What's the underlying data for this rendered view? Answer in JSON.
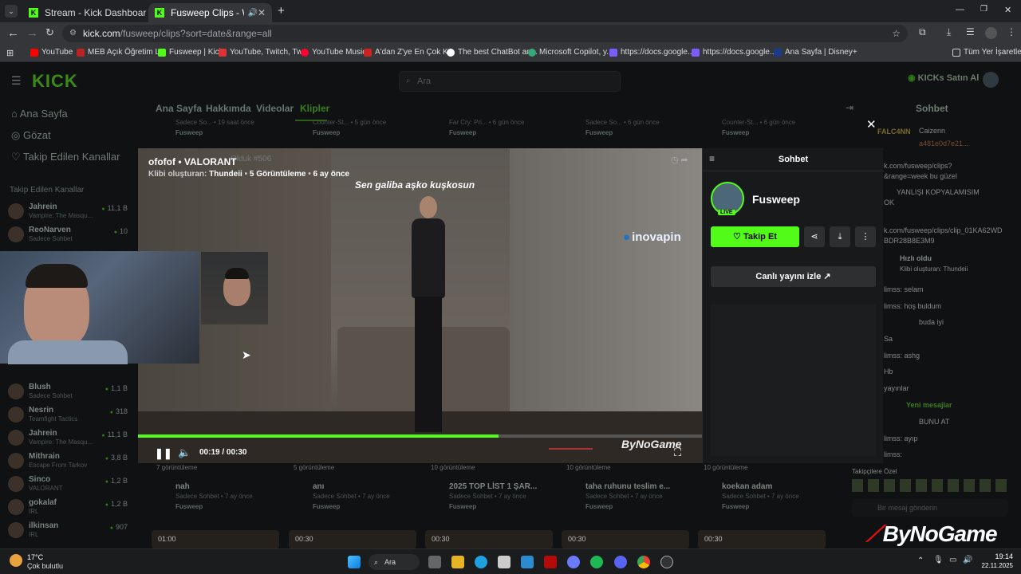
{
  "browser": {
    "tabs": [
      {
        "title": "Stream - Kick Dashboard"
      },
      {
        "title": "Fusweep Clips - Watch Live"
      }
    ],
    "url_host": "kick.com",
    "url_path": "/fusweep/clips?sort=date&range=all",
    "bookmarks": [
      "YouTube",
      "MEB Açık Öğretim L...",
      "Fusweep | Kick",
      "YouTube, Twitch, Tw...",
      "YouTube Music",
      "A'dan Z'ye En Çok K...",
      "The best ChatBot an...",
      "Microsoft Copilot, y...",
      "https://docs.google....",
      "https://docs.google....",
      "Ana Sayfa | Disney+"
    ],
    "all_bookmarks": "Tüm Yer İşaretleri"
  },
  "site": {
    "logo": "KICK",
    "search_placeholder": "Ara",
    "kicks_button": "KICKs Satın Al",
    "nav": [
      "Ana Sayfa",
      "Gözat",
      "Takip Edilen Kanallar"
    ],
    "followed_title": "Takip Edilen Kanallar",
    "channels": [
      {
        "name": "Jahrein",
        "game": "Vampire: The Masqu...",
        "viewers": "11,1 B"
      },
      {
        "name": "ReoNarven",
        "game": "Sadece Sohbet",
        "viewers": "10"
      },
      {
        "name": "Blush",
        "game": "Sadece Sohbet",
        "viewers": "1,1 B"
      },
      {
        "name": "Nesrin",
        "game": "Teamfight Tactics",
        "viewers": "318"
      },
      {
        "name": "Jahrein",
        "game": "Vampire: The Masqu...",
        "viewers": "11,1 B"
      },
      {
        "name": "Mithrain",
        "game": "Escape From Tarkov",
        "viewers": "3,8 B"
      },
      {
        "name": "Sinco",
        "game": "VALORANT",
        "viewers": "1,2 B"
      },
      {
        "name": "gokalaf",
        "game": "IRL",
        "viewers": "1,2 B"
      },
      {
        "name": "ilkinsan",
        "game": "IRL",
        "viewers": "907"
      }
    ],
    "page_tabs": [
      "Ana Sayfa",
      "Hakkımda",
      "Videolar",
      "Klipler"
    ],
    "active_tab": "Klipler",
    "chat_header": "Sohbet",
    "top_clips": [
      {
        "sub": "Sadece So... • 19 saat önce",
        "channel": "Fusweep"
      },
      {
        "sub": "Counter-St... • 5 gün önce",
        "channel": "Fusweep"
      },
      {
        "sub": "Far Cry: Pri... • 6 gün önce",
        "channel": "Fusweep"
      },
      {
        "sub": "Sadece So... • 6 gün önce",
        "channel": "Fusweep"
      },
      {
        "sub": "Counter-St... • 6 gün önce",
        "channel": "Fusweep"
      }
    ],
    "bottom_clips": [
      {
        "views": "7 görüntüleme",
        "title": "nah",
        "sub": "Sadece Sohbet • 7 ay önce",
        "channel": "Fusweep"
      },
      {
        "views": "5 görüntüleme",
        "title": "anı",
        "sub": "Sadece Sohbet • 7 ay önce",
        "channel": "Fusweep"
      },
      {
        "views": "10 görüntüleme",
        "title": "2025 TOP LİST 1 ŞAR...",
        "sub": "Sadece Sohbet • 7 ay önce",
        "channel": "Fusweep"
      },
      {
        "views": "10 görüntüleme",
        "title": "taha ruhunu teslim e...",
        "sub": "Sadece Sohbet • 7 ay önce",
        "channel": "Fusweep"
      },
      {
        "views": "10 görüntüleme",
        "title": "koekan adam",
        "sub": "Sadece Sohbet • 7 ay önce",
        "channel": "Fusweep"
      }
    ],
    "thumb_times": [
      "01:00",
      "00:30",
      "00:30",
      "00:30",
      "00:30"
    ],
    "chat_lines": [
      "FALC4NN",
      "Caizenn",
      "a481e0d7e21...",
      "k.com/fusweep/clips?",
      "&range=week bu güzel",
      "YANLIŞI KOPYALAMISIM",
      "OK",
      "k.com/fusweep/clips/clip_01KA62WD",
      "BDR28B8E3M9",
      "Hızlı oldu",
      "Klibi oluşturan: Thundeii",
      "limss: selam",
      "limss: hoş buldum",
      "buda iyi",
      "Sa",
      "limss: ashg",
      "Hb",
      "yayınlar",
      "Yeni mesajlar",
      "BUNU AT",
      "limss: ayıp",
      "limss:"
    ],
    "chat_input_placeholder": "Bir mesaj gönderin",
    "emote_label": "Takipçilere Özel"
  },
  "clip": {
    "title": "ofofof • VALORANT",
    "creator_prefix": "Klibi oluşturan:",
    "creator": "Thundeii",
    "views": "5 Görüntüleme",
    "age": "6 ay önce",
    "hidden_header": "Olduk #506",
    "caption": "Sen galiba aşko kuşkosun",
    "sponsor": "inovapin",
    "watermark": "ByNoGame",
    "time": "00:19 / 00:30",
    "progress": 0.64
  },
  "chat_panel": {
    "title": "Sohbet",
    "channel": "Fusweep",
    "live": "LIVE",
    "follow": "Takip Et",
    "watch_live": "Canlı yayını izle"
  },
  "overlay": {
    "watermark": "ByNoGame"
  },
  "taskbar": {
    "temp": "17°C",
    "weather": "Çok bulutlu",
    "search": "Ara",
    "time": "19:14",
    "date": "22.11.2025"
  },
  "colors": {
    "kick_green": "#53fc18"
  }
}
